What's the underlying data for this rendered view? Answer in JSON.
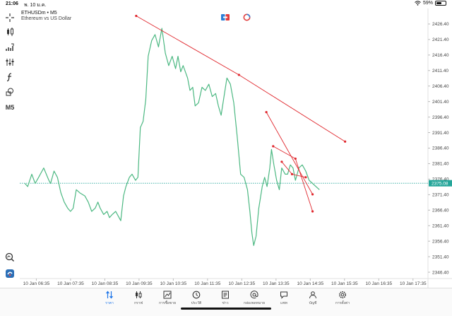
{
  "status_bar": {
    "time": "21:06",
    "date": "พ. 10 ม.ค.",
    "battery_text": "59%",
    "battery_level": 0.59
  },
  "symbol": {
    "line": "ETHUSDm • M5",
    "description": "Ethereum vs US Dollar"
  },
  "toolbar": {
    "timeframe": "M5"
  },
  "icons": [
    "crosshair-icon",
    "candlestick-icon",
    "indicator-icon",
    "chart-settings-icon",
    "function-icon",
    "shapes-icon",
    "zoom-icon",
    "app-logo-icon"
  ],
  "colors": {
    "line": "#4cb882",
    "trendline": "#e0282e",
    "current_price_bg": "#26a69a",
    "accent": "#1a73e8"
  },
  "chart_data": {
    "type": "line",
    "symbol": "ETHUSDm",
    "timeframe": "M5",
    "current_price": "2375.08",
    "ylim": [
      2341.4,
      2431.4
    ],
    "y_ticks": [
      "2426.40",
      "2421.40",
      "2416.40",
      "2411.40",
      "2406.40",
      "2401.40",
      "2396.40",
      "2391.40",
      "2386.40",
      "2381.40",
      "2376.40",
      "2371.40",
      "2366.40",
      "2361.40",
      "2356.40",
      "2351.40",
      "2346.40"
    ],
    "x_ticks": [
      "10 Jan 06:35",
      "10 Jan 07:35",
      "10 Jan 08:35",
      "10 Jan 09:35",
      "10 Jan 10:35",
      "10 Jan 11:35",
      "10 Jan 12:35",
      "10 Jan 13:35",
      "10 Jan 14:35",
      "10 Jan 15:35",
      "10 Jan 16:35",
      "10 Jan 17:35"
    ],
    "x_range_hours": [
      6.1,
      18.0
    ],
    "series": [
      {
        "points": [
          [
            6.25,
            2375
          ],
          [
            6.33,
            2374
          ],
          [
            6.45,
            2378
          ],
          [
            6.55,
            2375
          ],
          [
            6.65,
            2377
          ],
          [
            6.8,
            2380
          ],
          [
            6.95,
            2376
          ],
          [
            7.0,
            2375
          ],
          [
            7.1,
            2379
          ],
          [
            7.2,
            2377
          ],
          [
            7.3,
            2372
          ],
          [
            7.4,
            2369
          ],
          [
            7.5,
            2367
          ],
          [
            7.58,
            2366
          ],
          [
            7.66,
            2367
          ],
          [
            7.75,
            2373
          ],
          [
            7.85,
            2372
          ],
          [
            8.0,
            2371
          ],
          [
            8.1,
            2369
          ],
          [
            8.2,
            2366
          ],
          [
            8.3,
            2367
          ],
          [
            8.38,
            2369
          ],
          [
            8.45,
            2367
          ],
          [
            8.55,
            2365
          ],
          [
            8.65,
            2366
          ],
          [
            8.72,
            2364
          ],
          [
            8.8,
            2365
          ],
          [
            8.9,
            2366
          ],
          [
            9.0,
            2364
          ],
          [
            9.05,
            2363
          ],
          [
            9.13,
            2371
          ],
          [
            9.2,
            2374
          ],
          [
            9.3,
            2377
          ],
          [
            9.38,
            2378
          ],
          [
            9.48,
            2376
          ],
          [
            9.55,
            2377
          ],
          [
            9.62,
            2393
          ],
          [
            9.7,
            2395
          ],
          [
            9.78,
            2402
          ],
          [
            9.85,
            2416
          ],
          [
            9.95,
            2421
          ],
          [
            10.05,
            2423
          ],
          [
            10.15,
            2419
          ],
          [
            10.25,
            2425
          ],
          [
            10.35,
            2417
          ],
          [
            10.45,
            2413
          ],
          [
            10.55,
            2416
          ],
          [
            10.65,
            2412
          ],
          [
            10.72,
            2416
          ],
          [
            10.8,
            2411
          ],
          [
            10.87,
            2413
          ],
          [
            11.0,
            2409
          ],
          [
            11.07,
            2405
          ],
          [
            11.15,
            2406
          ],
          [
            11.22,
            2400
          ],
          [
            11.32,
            2401
          ],
          [
            11.42,
            2406
          ],
          [
            11.52,
            2405
          ],
          [
            11.62,
            2407
          ],
          [
            11.72,
            2403
          ],
          [
            11.82,
            2404
          ],
          [
            11.9,
            2400
          ],
          [
            11.98,
            2397
          ],
          [
            12.05,
            2402
          ],
          [
            12.15,
            2409
          ],
          [
            12.25,
            2407
          ],
          [
            12.35,
            2401
          ],
          [
            12.45,
            2390
          ],
          [
            12.55,
            2378
          ],
          [
            12.65,
            2377
          ],
          [
            12.75,
            2373
          ],
          [
            12.82,
            2366
          ],
          [
            12.88,
            2359
          ],
          [
            12.93,
            2355
          ],
          [
            13.0,
            2358
          ],
          [
            13.08,
            2367
          ],
          [
            13.18,
            2374
          ],
          [
            13.25,
            2377
          ],
          [
            13.32,
            2374
          ],
          [
            13.4,
            2380
          ],
          [
            13.45,
            2386
          ],
          [
            13.52,
            2381
          ],
          [
            13.6,
            2376
          ],
          [
            13.68,
            2373
          ],
          [
            13.75,
            2380
          ],
          [
            13.85,
            2378
          ],
          [
            13.92,
            2378
          ],
          [
            14.0,
            2381
          ],
          [
            14.08,
            2380
          ],
          [
            14.15,
            2376
          ],
          [
            14.25,
            2380
          ],
          [
            14.35,
            2381
          ],
          [
            14.45,
            2379
          ],
          [
            14.55,
            2376
          ],
          [
            14.65,
            2375
          ],
          [
            14.75,
            2374
          ],
          [
            14.85,
            2373
          ]
        ]
      }
    ],
    "trendlines": [
      {
        "points": [
          [
            9.5,
            2429
          ],
          [
            12.5,
            2410
          ],
          [
            15.6,
            2388.5
          ]
        ]
      },
      {
        "points": [
          [
            13.3,
            2398
          ],
          [
            14.65,
            2371.5
          ]
        ]
      },
      {
        "points": [
          [
            13.5,
            2387
          ],
          [
            14.15,
            2383
          ],
          [
            14.65,
            2366
          ]
        ]
      },
      {
        "points": [
          [
            13.75,
            2382
          ],
          [
            14.05,
            2378
          ],
          [
            14.45,
            2377
          ]
        ]
      }
    ]
  },
  "bottom_nav": [
    {
      "id": "quotes",
      "label": "ราคา",
      "icon": "quotes-icon",
      "active": true
    },
    {
      "id": "chart",
      "label": "กราฟ",
      "icon": "chart-icon",
      "active": false
    },
    {
      "id": "trade",
      "label": "การซื้อขาย",
      "icon": "trade-icon",
      "active": false
    },
    {
      "id": "history",
      "label": "ประวัติ",
      "icon": "history-icon",
      "active": false
    },
    {
      "id": "news",
      "label": "ข่าว",
      "icon": "news-icon",
      "active": false
    },
    {
      "id": "mailbox",
      "label": "กล่องจดหมาย",
      "icon": "mailbox-icon",
      "active": false
    },
    {
      "id": "chat",
      "label": "แชท",
      "icon": "chat-icon",
      "active": false
    },
    {
      "id": "accounts",
      "label": "บัญชี",
      "icon": "accounts-icon",
      "active": false
    },
    {
      "id": "settings",
      "label": "การตั้งค่า",
      "icon": "settings-icon",
      "active": false
    }
  ]
}
